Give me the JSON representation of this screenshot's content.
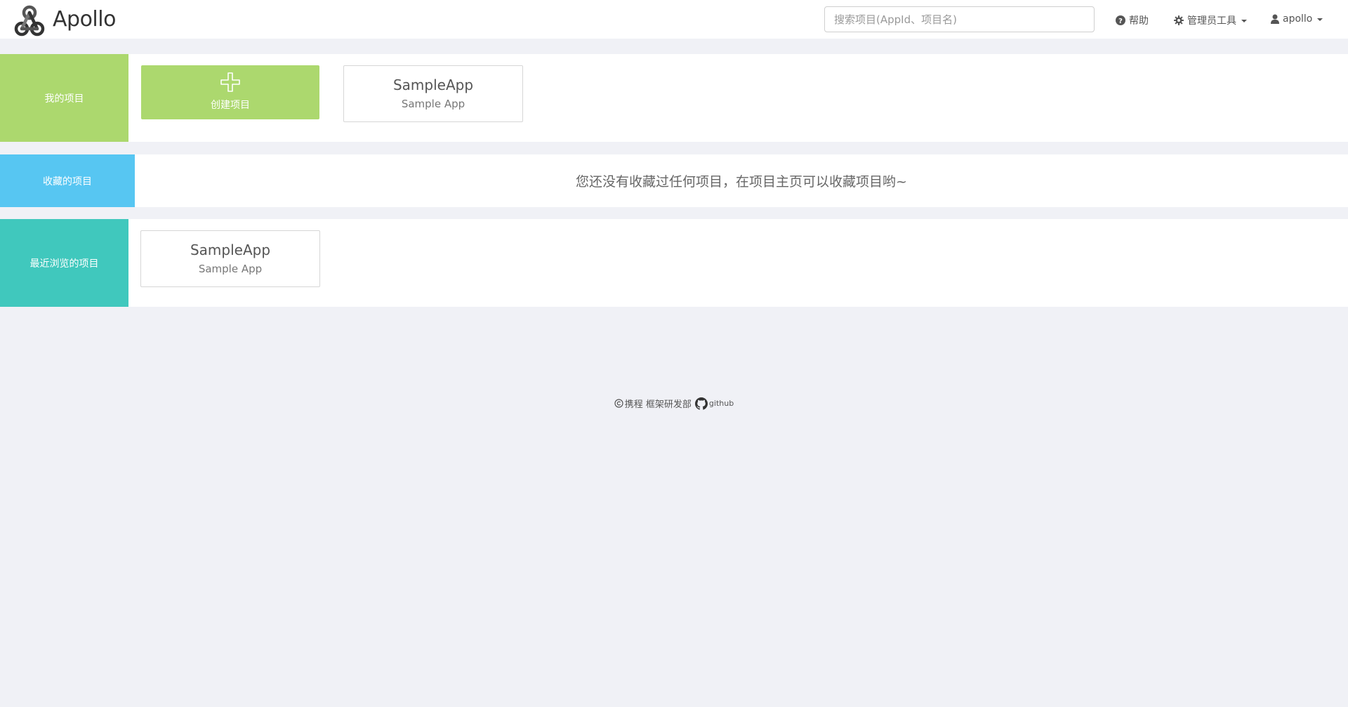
{
  "colors": {
    "my_projects": "#acd86e",
    "favorites": "#57c6f2",
    "recent": "#40c8bd",
    "create_button": "#acd86e",
    "background": "#f0f1f6"
  },
  "navbar": {
    "brand": "Apollo",
    "search_placeholder": "搜索项目(AppId、项目名)",
    "help": "帮助",
    "admin_tools": "管理员工具",
    "user": "apollo"
  },
  "my_projects": {
    "label": "我的项目",
    "create_label": "创建项目",
    "apps": [
      {
        "name": "SampleApp",
        "desc": "Sample App"
      }
    ]
  },
  "favorites": {
    "label": "收藏的项目",
    "empty_text": "您还没有收藏过任何项目，在项目主页可以收藏项目哟~"
  },
  "recent": {
    "label": "最近浏览的项目",
    "apps": [
      {
        "name": "SampleApp",
        "desc": "Sample App"
      }
    ]
  },
  "footer": {
    "company": "携程 框架研发部",
    "github": "github"
  }
}
